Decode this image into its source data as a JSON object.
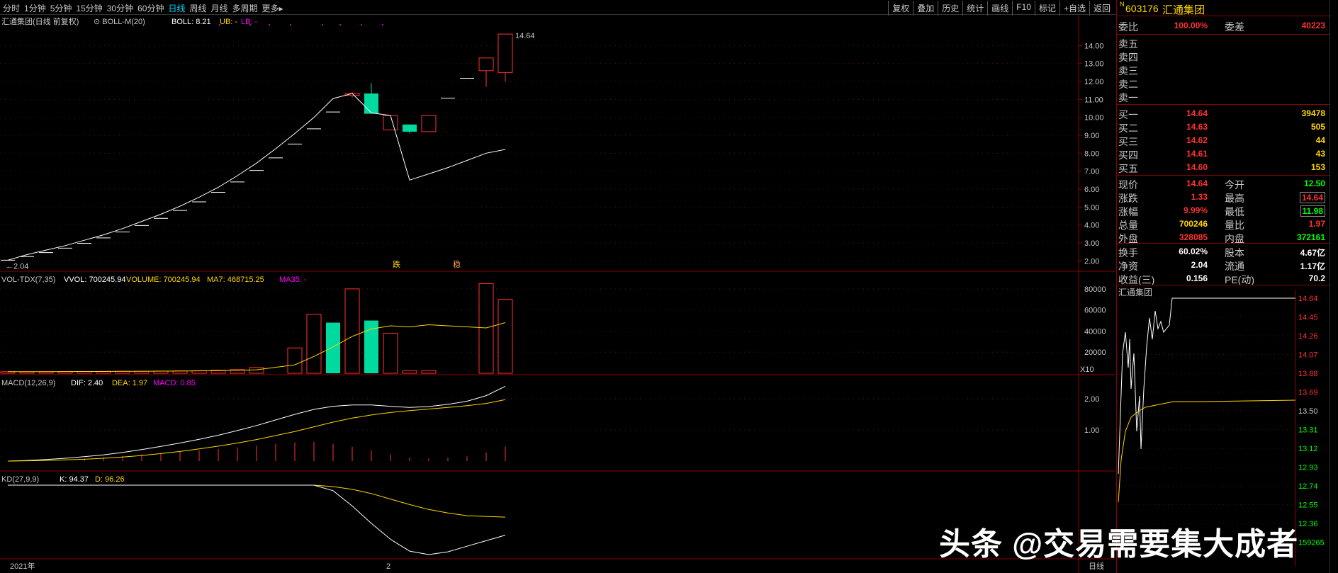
{
  "toolbar": {
    "periods": [
      "分时",
      "1分钟",
      "5分钟",
      "15分钟",
      "30分钟",
      "60分钟",
      "日线",
      "周线",
      "月线",
      "多周期",
      "更多▸"
    ],
    "active_period": "日线",
    "right_buttons": [
      "复权",
      "叠加",
      "历史",
      "统计",
      "画线",
      "F10",
      "标记",
      "+自选",
      "返回"
    ]
  },
  "main": {
    "stock_label": "汇通集团(日线 前复权)",
    "indicator_label": "BOLL-M(20)",
    "boll_value": "BOLL: 8.21",
    "ub_value": "UB: -",
    "lb_value": "LB: -",
    "high_label": "14.64",
    "low_label": "2.04",
    "ticks": [
      "14.00",
      "13.00",
      "12.00",
      "11.00",
      "10.00",
      "9.00",
      "8.00",
      "7.00",
      "6.00",
      "5.00",
      "4.00",
      "3.00",
      "2.00"
    ],
    "marker_die": "跌",
    "marker_wen": "稳",
    "colors": {
      "up": "#ff3232",
      "down": "#00d9a0",
      "boll": "#ffffff"
    }
  },
  "volume": {
    "label": "VOL-TDX(7,35)",
    "vvol": "VVOL: 700245.94",
    "volume_text": "VOLUME: 700245.94",
    "ma7": "MA7: 468715.25",
    "ma35": "MA35: -",
    "ticks": [
      "80000",
      "60000",
      "40000",
      "20000"
    ],
    "unit": "X10"
  },
  "macd": {
    "label": "MACD(12,26,9)",
    "dif": "DIF: 2.40",
    "dea": "DEA: 1.97",
    "macd": "MACD: 0.85",
    "ticks": [
      "2.00",
      "1.00"
    ]
  },
  "kd": {
    "label": "KD(27,9,9)",
    "k": "K: 94.37",
    "d": "D: 96.26"
  },
  "xaxis": {
    "year": "2021年",
    "mid": "2",
    "period": "日线"
  },
  "panel": {
    "code_prefix": "N",
    "code": "603176",
    "name": "汇通集团",
    "weibi_label": "委比",
    "weibi_value": "100.00%",
    "weicha_label": "委差",
    "weicha_value": "40223",
    "sell": [
      "卖五",
      "卖四",
      "卖三",
      "卖二",
      "卖一"
    ],
    "buy": [
      {
        "label": "买一",
        "price": "14.64",
        "vol": "39478"
      },
      {
        "label": "买二",
        "price": "14.63",
        "vol": "505"
      },
      {
        "label": "买三",
        "price": "14.62",
        "vol": "44"
      },
      {
        "label": "买四",
        "price": "14.61",
        "vol": "43"
      },
      {
        "label": "买五",
        "price": "14.60",
        "vol": "153"
      }
    ],
    "stats": [
      {
        "l1": "现价",
        "v1": "14.64",
        "l2": "今开",
        "v2": "12.50"
      },
      {
        "l1": "涨跌",
        "v1": "1.33",
        "l2": "最高",
        "v2": "14.64"
      },
      {
        "l1": "涨幅",
        "v1": "9.99%",
        "l2": "最低",
        "v2": "11.98"
      },
      {
        "l1": "总量",
        "v1": "700246",
        "l2": "量比",
        "v2": "1.97"
      },
      {
        "l1": "外盘",
        "v1": "328085",
        "l2": "内盘",
        "v2": "372161"
      }
    ],
    "fin": [
      {
        "l1": "换手",
        "v1": "60.02%",
        "l2": "股本",
        "v2": "4.67亿"
      },
      {
        "l1": "净资",
        "v1": "2.04",
        "l2": "流通",
        "v2": "1.17亿"
      },
      {
        "l1": "收益(三)",
        "v1": "0.156",
        "l2": "PE(动)",
        "v2": "70.2"
      }
    ],
    "intraday_title": "汇通集团",
    "intraday_ticks": [
      "14.64",
      "14.45",
      "14.26",
      "14.07",
      "13.88",
      "13.69",
      "13.50",
      "13.31",
      "13.12",
      "12.93",
      "12.74",
      "12.55",
      "12.36",
      "159265"
    ]
  },
  "watermark": "头条 @交易需要集大成者",
  "chart_data": {
    "type": "candlestick",
    "title": "汇通集团(日线 前复权)",
    "candles": [
      {
        "o": 2.04,
        "c": 2.04,
        "h": 2.04,
        "l": 2.04
      },
      {
        "o": 2.24,
        "c": 2.24,
        "h": 2.24,
        "l": 2.24
      },
      {
        "o": 2.46,
        "c": 2.46,
        "h": 2.46,
        "l": 2.46
      },
      {
        "o": 2.71,
        "c": 2.71,
        "h": 2.71,
        "l": 2.71
      },
      {
        "o": 2.98,
        "c": 2.98,
        "h": 2.98,
        "l": 2.98
      },
      {
        "o": 3.28,
        "c": 3.28,
        "h": 3.28,
        "l": 3.28
      },
      {
        "o": 3.61,
        "c": 3.61,
        "h": 3.61,
        "l": 3.61
      },
      {
        "o": 3.97,
        "c": 3.97,
        "h": 3.97,
        "l": 3.97
      },
      {
        "o": 4.37,
        "c": 4.37,
        "h": 4.37,
        "l": 4.37
      },
      {
        "o": 4.81,
        "c": 4.81,
        "h": 4.81,
        "l": 4.81
      },
      {
        "o": 5.29,
        "c": 5.29,
        "h": 5.29,
        "l": 5.29
      },
      {
        "o": 5.82,
        "c": 5.82,
        "h": 5.82,
        "l": 5.82
      },
      {
        "o": 6.4,
        "c": 6.4,
        "h": 6.4,
        "l": 6.4
      },
      {
        "o": 7.04,
        "c": 7.04,
        "h": 7.04,
        "l": 7.04
      },
      {
        "o": 7.74,
        "c": 7.74,
        "h": 7.74,
        "l": 7.74
      },
      {
        "o": 8.51,
        "c": 8.51,
        "h": 8.51,
        "l": 8.51
      },
      {
        "o": 9.36,
        "c": 9.36,
        "h": 9.36,
        "l": 9.36
      },
      {
        "o": 10.3,
        "c": 10.3,
        "h": 10.3,
        "l": 10.3
      },
      {
        "o": 11.22,
        "c": 11.33,
        "h": 11.4,
        "l": 11.1
      },
      {
        "o": 11.33,
        "c": 10.2,
        "h": 11.9,
        "l": 10.2
      },
      {
        "o": 9.3,
        "c": 10.1,
        "h": 10.1,
        "l": 9.3
      },
      {
        "o": 9.6,
        "c": 9.2,
        "h": 9.6,
        "l": 9.1
      },
      {
        "o": 9.2,
        "c": 10.1,
        "h": 10.1,
        "l": 9.2
      },
      {
        "o": 11.07,
        "c": 11.07,
        "h": 11.07,
        "l": 11.07
      },
      {
        "o": 12.18,
        "c": 12.18,
        "h": 12.18,
        "l": 12.18
      },
      {
        "o": 12.6,
        "c": 13.31,
        "h": 13.31,
        "l": 11.7
      },
      {
        "o": 12.5,
        "c": 14.64,
        "h": 14.64,
        "l": 11.98
      }
    ],
    "boll_mid": [
      2.04,
      2.14,
      2.25,
      2.36,
      2.49,
      2.63,
      2.79,
      2.96,
      3.15,
      3.36,
      3.59,
      3.85,
      4.13,
      4.44,
      4.78,
      5.15,
      5.56,
      6.01,
      6.45,
      6.98,
      7.5,
      7.97,
      8.45,
      8.87,
      9.3,
      9.73,
      10.28,
      10.8,
      11.25,
      10.32,
      10.1,
      10.1,
      6.1,
      6.26,
      6.44,
      6.62,
      6.8,
      6.98,
      7.2,
      7.42,
      7.64,
      7.84,
      8.04,
      8.21
    ],
    "volume": [
      1400,
      1500,
      1600,
      1700,
      1800,
      1900,
      2000,
      2100,
      2200,
      2300,
      2400,
      2600,
      3000,
      6000,
      28000,
      55000,
      49000,
      80000,
      51000,
      38000,
      2600,
      2700,
      85000,
      70000
    ],
    "vol_ma7": [
      1400,
      1500,
      1550,
      1600,
      1650,
      1700,
      1800,
      1900,
      2000,
      2100,
      2200,
      2300,
      3000,
      5000,
      9000,
      16000,
      24000,
      33000,
      40000,
      44000,
      44000,
      46000,
      43000,
      48000
    ],
    "ylim": [
      1.5,
      15.0
    ]
  }
}
